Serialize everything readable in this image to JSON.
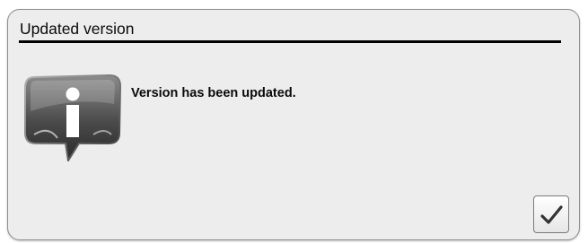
{
  "dialog": {
    "title": "Updated version",
    "message": "Version has been updated.",
    "icon": "info-speech-bubble-icon",
    "confirm_icon": "checkmark-icon"
  }
}
